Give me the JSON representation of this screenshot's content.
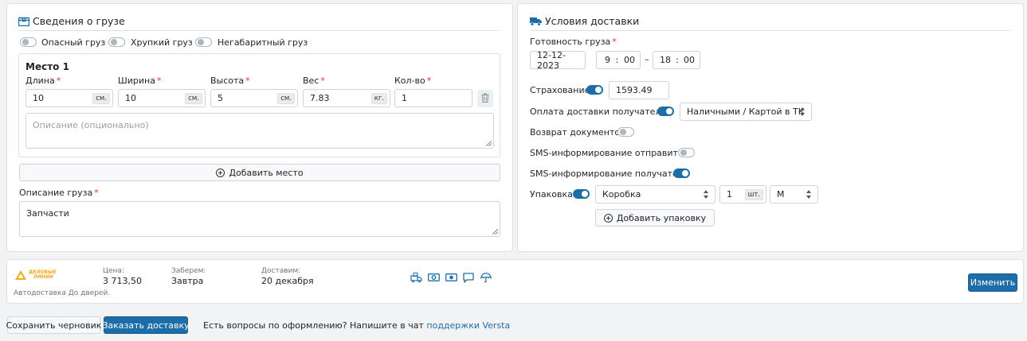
{
  "cargo": {
    "title": "Сведения о грузе",
    "toggles": [
      {
        "label": "Опасный груз",
        "on": false
      },
      {
        "label": "Хрупкий груз",
        "on": false
      },
      {
        "label": "Негабаритный груз",
        "on": false
      }
    ],
    "place": {
      "title": "Место 1",
      "length": {
        "label": "Длина",
        "value": "10",
        "unit": "см."
      },
      "width": {
        "label": "Ширина",
        "value": "10",
        "unit": "см."
      },
      "height": {
        "label": "Высота",
        "value": "5",
        "unit": "см."
      },
      "weight": {
        "label": "Вес",
        "value": "7.83",
        "unit": "кг."
      },
      "qty": {
        "label": "Кол-во",
        "value": "1"
      },
      "description_placeholder": "Описание (опционально)"
    },
    "add_place_label": "Добавить место",
    "description": {
      "label": "Описание груза",
      "value": "Запчасти"
    }
  },
  "delivery": {
    "title": "Условия доставки",
    "readiness": {
      "label": "Готовность груза",
      "date": "12-12-2023",
      "from_h": "9",
      "from_m": "00",
      "to_h": "18",
      "to_m": "00",
      "dash": "–",
      "colon": ":"
    },
    "insurance": {
      "label": "Страхование",
      "on": true,
      "value": "1593.49"
    },
    "recipient_pays": {
      "label": "Оплата доставки получателем",
      "on": true,
      "option": "Наличными / Картой в ТК"
    },
    "return_docs": {
      "label": "Возврат документов",
      "on": false
    },
    "sms_sender": {
      "label": "SMS-информирование отправителя",
      "on": false
    },
    "sms_recipient": {
      "label": "SMS-информирование получателя",
      "on": true
    },
    "packaging": {
      "label": "Упаковка",
      "on": true,
      "type": "Коробка",
      "qty": "1",
      "qty_unit": "шт.",
      "size": "M"
    },
    "add_packaging_label": "Добавить упаковку"
  },
  "carrier": {
    "logo_text_1": "ДЕЛОВЫЕ",
    "logo_text_2": "ЛИНИИ",
    "service": "Автодоставка До дверей.",
    "price_label": "Цена:",
    "price_value": "3 713,50",
    "pickup_label": "Заберем:",
    "pickup_value": "Завтра",
    "deliver_label": "Доставим:",
    "deliver_value": "20 декабря",
    "service_icons": [
      "truck-docs-icon",
      "cash-icon",
      "cash-on-delivery-icon",
      "chat-icon",
      "umbrella-icon"
    ],
    "change_label": "Изменить"
  },
  "footer": {
    "save_draft": "Сохранить черновик",
    "order": "Заказать доставку",
    "help_text": "Есть вопросы по оформлению? Напишите в чат",
    "help_link": "поддержки Versta"
  },
  "colors": {
    "accent": "#1d6ea8",
    "required": "#d9363e",
    "logo": "#f4a81d"
  }
}
